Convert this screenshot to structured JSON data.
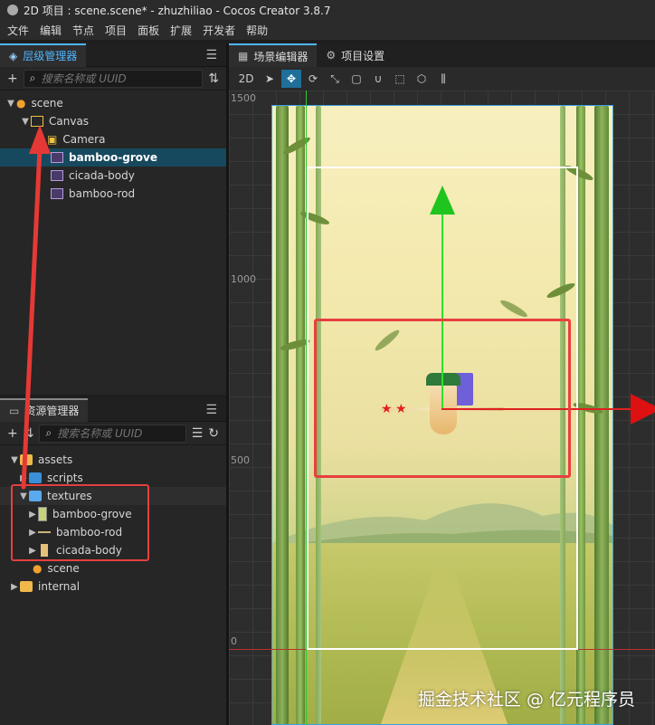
{
  "window": {
    "title": "2D 项目 : scene.scene* - zhuzhiliao - Cocos Creator 3.8.7"
  },
  "menu": [
    "文件",
    "编辑",
    "节点",
    "项目",
    "面板",
    "扩展",
    "开发者",
    "帮助"
  ],
  "hierarchy": {
    "tab_label": "层级管理器",
    "search_placeholder": "搜索名称或 UUID",
    "nodes": [
      {
        "label": "scene",
        "type": "scene",
        "depth": 0,
        "expanded": true
      },
      {
        "label": "Canvas",
        "type": "canvas",
        "depth": 1,
        "expanded": true
      },
      {
        "label": "Camera",
        "type": "camera",
        "depth": 2
      },
      {
        "label": "bamboo-grove",
        "type": "sprite",
        "depth": 2,
        "selected": true
      },
      {
        "label": "cicada-body",
        "type": "sprite",
        "depth": 2
      },
      {
        "label": "bamboo-rod",
        "type": "sprite",
        "depth": 2
      }
    ]
  },
  "assets": {
    "tab_label": "资源管理器",
    "search_placeholder": "搜索名称或 UUID",
    "items": [
      {
        "label": "assets",
        "type": "db",
        "depth": 0,
        "expanded": true
      },
      {
        "label": "scripts",
        "type": "folder",
        "depth": 1,
        "expanded": false
      },
      {
        "label": "textures",
        "type": "folder-open",
        "depth": 1,
        "expanded": true
      },
      {
        "label": "bamboo-grove",
        "type": "texture",
        "depth": 2
      },
      {
        "label": "bamboo-rod",
        "type": "texture",
        "depth": 2
      },
      {
        "label": "cicada-body",
        "type": "texture",
        "depth": 2
      },
      {
        "label": "scene",
        "type": "scene",
        "depth": 1
      },
      {
        "label": "internal",
        "type": "db",
        "depth": 0,
        "expanded": false
      }
    ]
  },
  "editor": {
    "tabs": [
      {
        "label": "场景编辑器",
        "active": true,
        "icon": "scene-editor-icon"
      },
      {
        "label": "项目设置",
        "active": false,
        "icon": "gear-icon"
      }
    ],
    "toolbar": {
      "mode_2d": "2D"
    },
    "ruler": [
      "1500",
      "1000",
      "500",
      "0"
    ]
  },
  "watermark": "掘金技术社区 @ 亿元程序员",
  "colors": {
    "accent": "#4fb6ff",
    "selection": "#17495e",
    "annotation_red": "#e74040",
    "gizmo_x": "#e02020",
    "gizmo_y": "#1fc41f"
  }
}
